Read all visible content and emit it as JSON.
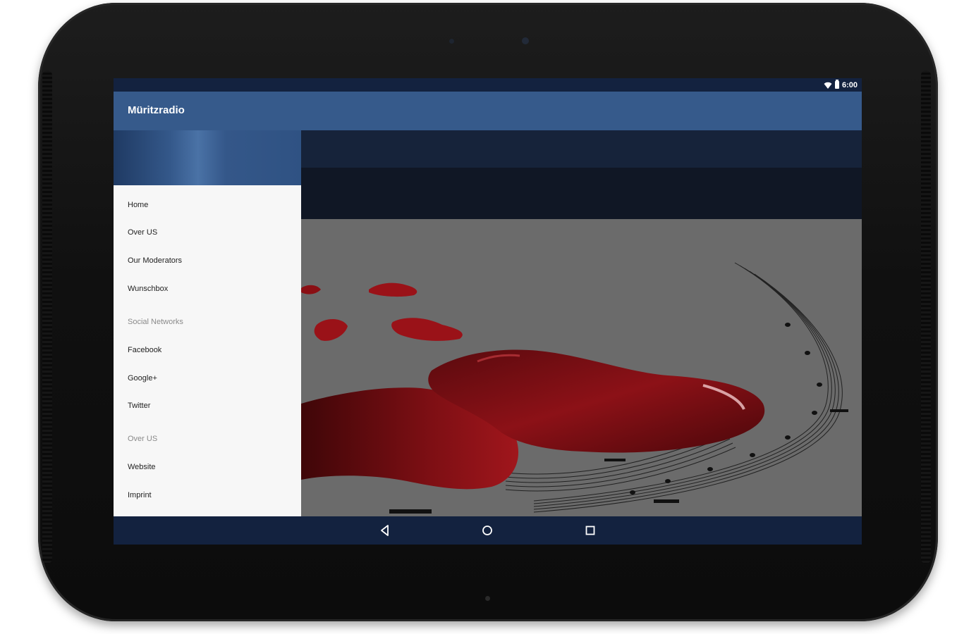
{
  "status_bar": {
    "time": "6:00",
    "icons": [
      "wifi-icon",
      "battery-icon"
    ]
  },
  "app_bar": {
    "title": "Müritzradio"
  },
  "drawer": {
    "items": [
      {
        "label": "Home",
        "type": "item"
      },
      {
        "label": "Over US",
        "type": "item"
      },
      {
        "label": "Our Moderators",
        "type": "item"
      },
      {
        "label": "Wunschbox",
        "type": "item"
      },
      {
        "label": "Social Networks",
        "type": "section"
      },
      {
        "label": "Facebook",
        "type": "item"
      },
      {
        "label": "Google+",
        "type": "item"
      },
      {
        "label": "Twitter",
        "type": "item"
      },
      {
        "label": "Over US",
        "type": "section"
      },
      {
        "label": "Website",
        "type": "item"
      },
      {
        "label": "Imprint",
        "type": "item"
      }
    ]
  },
  "nav_bar": {
    "buttons": [
      "back-icon",
      "home-icon",
      "recents-icon"
    ]
  },
  "colors": {
    "app_bar": "#365a8b",
    "status_bar": "#13223f",
    "drawer_bg": "#f7f7f7",
    "heart_red": "#8a0f14"
  }
}
